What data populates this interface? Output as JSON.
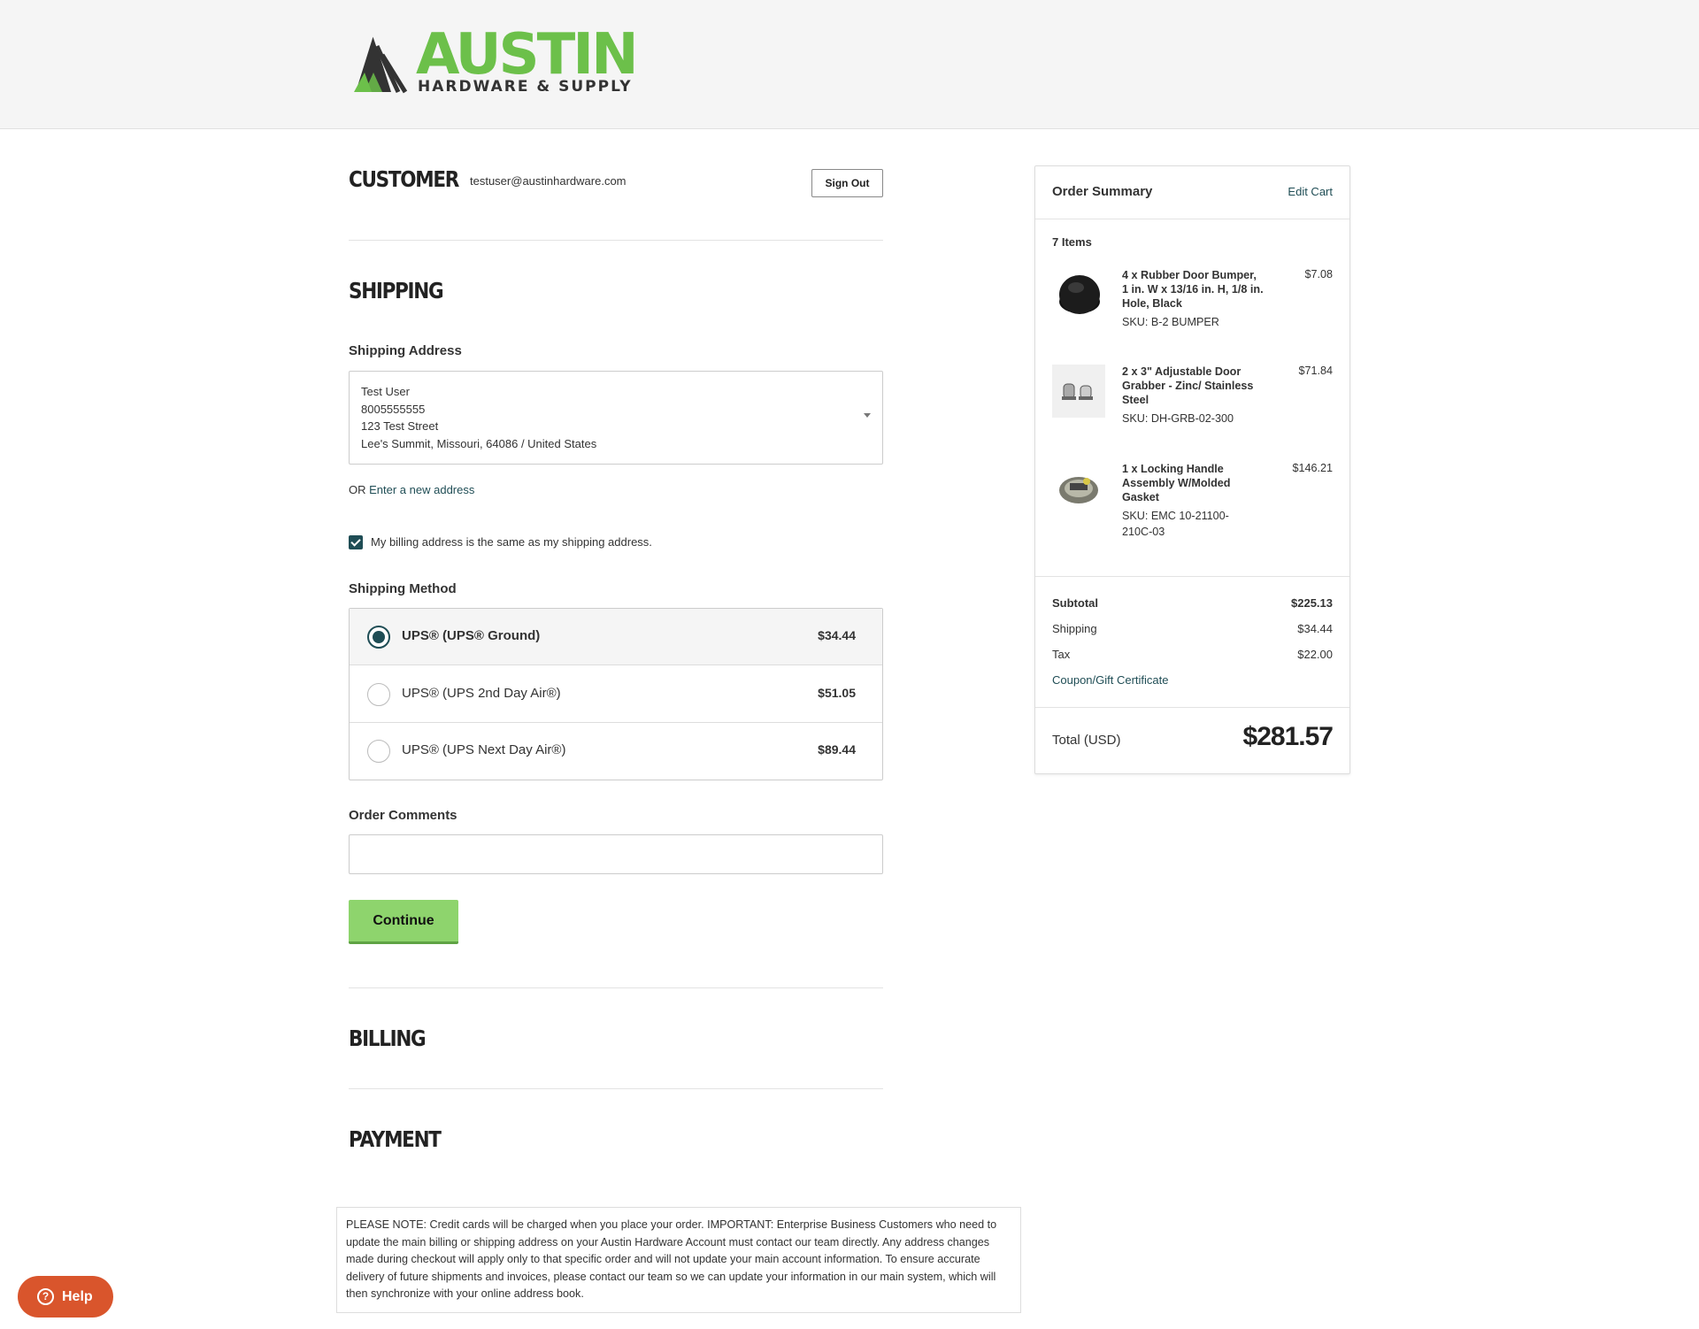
{
  "brand": {
    "name": "AUSTIN",
    "tagline": "HARDWARE & SUPPLY",
    "color_green": "#6cc04a",
    "color_dark": "#333333"
  },
  "customer": {
    "heading": "CUSTOMER",
    "email": "testuser@austinhardware.com",
    "sign_out_label": "Sign Out"
  },
  "shipping": {
    "heading": "SHIPPING",
    "address_label": "Shipping Address",
    "address": {
      "name": "Test User",
      "phone": "8005555555",
      "street": "123 Test Street",
      "city_line": "Lee's Summit, Missouri, 64086 / United States"
    },
    "or_text": "OR ",
    "new_address_link": "Enter a new address",
    "billing_same_label": "My billing address is the same as my shipping address.",
    "billing_same_checked": true,
    "method_label": "Shipping Method",
    "methods": [
      {
        "name": "UPS® (UPS® Ground)",
        "price": "$34.44",
        "selected": true
      },
      {
        "name": "UPS® (UPS 2nd Day Air®)",
        "price": "$51.05",
        "selected": false
      },
      {
        "name": "UPS® (UPS Next Day Air®)",
        "price": "$89.44",
        "selected": false
      }
    ],
    "comments_label": "Order Comments",
    "comments_value": "",
    "continue_label": "Continue"
  },
  "billing": {
    "heading": "BILLING"
  },
  "payment": {
    "heading": "PAYMENT"
  },
  "note": "PLEASE NOTE: Credit cards will be charged when you place your order. IMPORTANT: Enterprise Business Customers who need to update the main billing or shipping address on your Austin Hardware Account must contact our team directly. Any address changes made during checkout will apply only to that specific order and will not update your main account information. To ensure accurate delivery of future shipments and invoices, please contact our team so we can update your information in our main system, which will then synchronize with your online address book.",
  "help": {
    "label": "Help",
    "icon": "question-icon"
  },
  "summary": {
    "title": "Order Summary",
    "edit_cart": "Edit Cart",
    "items_count": "7 Items",
    "items": [
      {
        "name": "4 x Rubber Door Bumper, 1 in. W x 13/16 in. H, 1/8 in. Hole, Black",
        "sku": "SKU: B-2 BUMPER",
        "price": "$7.08"
      },
      {
        "name": "2 x 3\" Adjustable Door Grabber - Zinc/ Stainless Steel",
        "sku": "SKU: DH-GRB-02-300",
        "price": "$71.84"
      },
      {
        "name": "1 x Locking Handle Assembly W/Molded Gasket",
        "sku": "SKU: EMC 10-21100-210C-03",
        "price": "$146.21"
      }
    ],
    "subtotal_label": "Subtotal",
    "subtotal": "$225.13",
    "shipping_label": "Shipping",
    "shipping": "$34.44",
    "tax_label": "Tax",
    "tax": "$22.00",
    "coupon_link": "Coupon/Gift Certificate",
    "total_label": "Total (USD)",
    "total": "$281.57"
  },
  "colors": {
    "accent": "#1f4d55",
    "continue_button": "#8ed46d",
    "help_button": "#d9552c"
  }
}
